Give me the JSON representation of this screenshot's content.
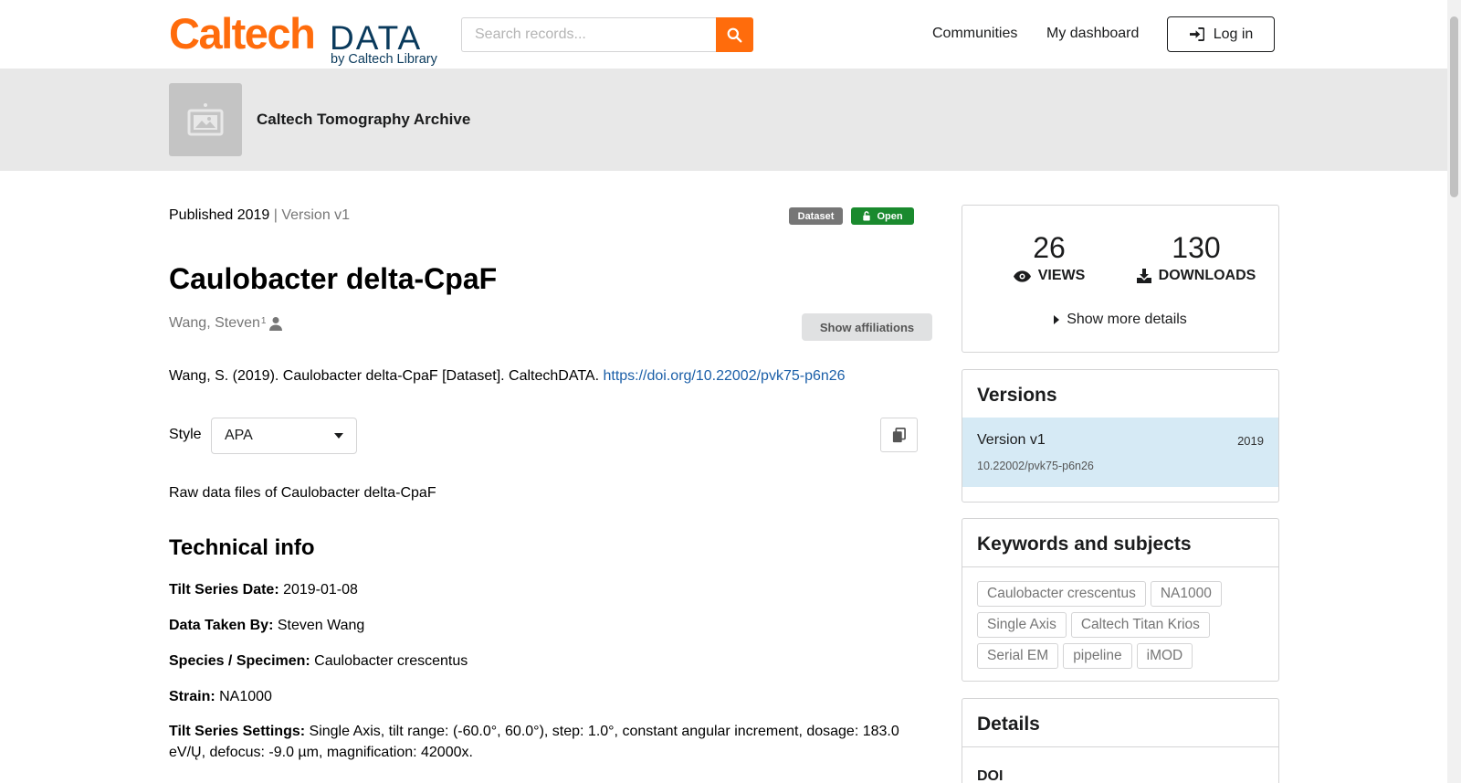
{
  "header": {
    "logo_caltech": "Caltech",
    "logo_data": "DATA",
    "logo_by": "by Caltech Library",
    "search_placeholder": "Search records...",
    "nav": [
      "Communities",
      "My dashboard"
    ],
    "login_label": "Log in",
    "accent_color": "#FF6C0C"
  },
  "community": {
    "name": "Caltech Tomography Archive"
  },
  "record": {
    "published": "Published 2019",
    "separator": " | ",
    "version": "Version v1",
    "badge_type": "Dataset",
    "badge_access": "Open",
    "title": "Caulobacter delta-CpaF",
    "creator_name": "Wang, Steven",
    "creator_affiliation_mark": "1",
    "show_affiliations": "Show affiliations",
    "citation_text": "Wang, S. (2019). Caulobacter delta-CpaF [Dataset]. CaltechDATA. ",
    "citation_doi": "https://doi.org/10.22002/pvk75-p6n26",
    "style_label": "Style",
    "style_value": "APA",
    "description": "Raw data files of Caulobacter delta-CpaF"
  },
  "technical_info": {
    "heading": "Technical info",
    "rows": [
      {
        "label": "Tilt Series Date:",
        "value": " 2019-01-08"
      },
      {
        "label": "Data Taken By:",
        "value": " Steven Wang"
      },
      {
        "label": "Species / Specimen:",
        "value": " Caulobacter crescentus"
      },
      {
        "label": "Strain:",
        "value": " NA1000"
      },
      {
        "label": "Tilt Series Settings:",
        "value": " Single Axis, tilt range: (-60.0°, 60.0°), step: 1.0°, constant angular increment, dosage: 183.0 eV/Ų, defocus: -9.0 µm, magnification: 42000x."
      }
    ]
  },
  "sidebar": {
    "views_count": "26",
    "views_label": "VIEWS",
    "downloads_count": "130",
    "downloads_label": "DOWNLOADS",
    "show_more": "Show more details",
    "versions_title": "Versions",
    "version_item_name": "Version v1",
    "version_item_year": "2019",
    "version_item_doi": "10.22002/pvk75-p6n26",
    "keywords_title": "Keywords and subjects",
    "keywords": [
      "Caulobacter crescentus",
      "NA1000",
      "Single Axis",
      "Caltech Titan Krios",
      "Serial EM",
      "pipeline",
      "iMOD"
    ],
    "details_title": "Details",
    "details_doi_label": "DOI"
  }
}
